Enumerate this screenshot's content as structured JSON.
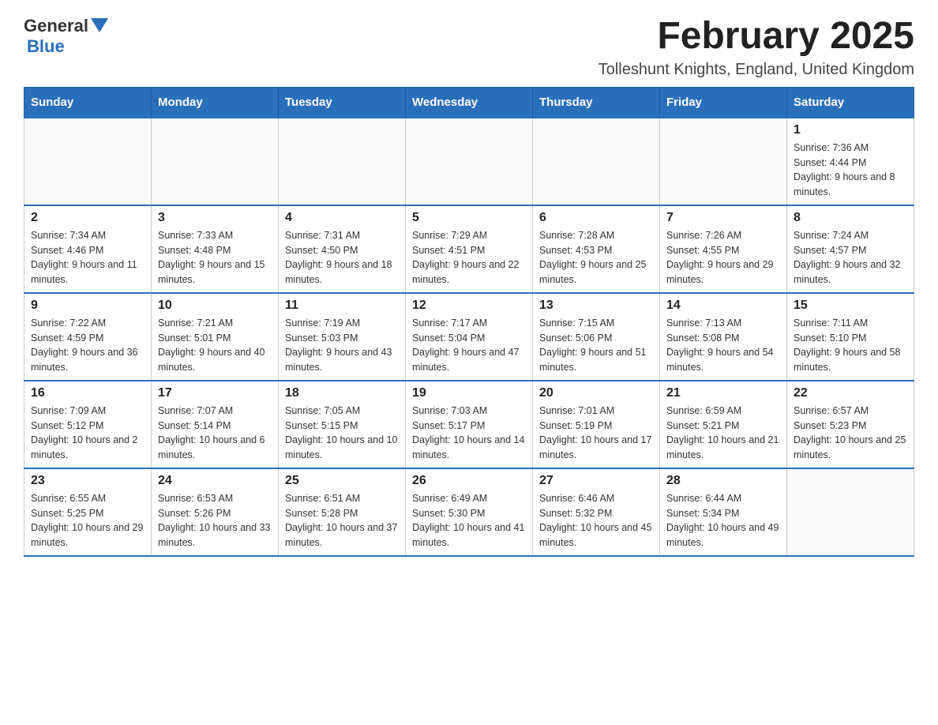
{
  "header": {
    "logo": {
      "general": "General",
      "blue": "Blue"
    },
    "title": "February 2025",
    "location": "Tolleshunt Knights, England, United Kingdom"
  },
  "days_of_week": [
    "Sunday",
    "Monday",
    "Tuesday",
    "Wednesday",
    "Thursday",
    "Friday",
    "Saturday"
  ],
  "weeks": [
    [
      {
        "day": "",
        "info": ""
      },
      {
        "day": "",
        "info": ""
      },
      {
        "day": "",
        "info": ""
      },
      {
        "day": "",
        "info": ""
      },
      {
        "day": "",
        "info": ""
      },
      {
        "day": "",
        "info": ""
      },
      {
        "day": "1",
        "info": "Sunrise: 7:36 AM\nSunset: 4:44 PM\nDaylight: 9 hours and 8 minutes."
      }
    ],
    [
      {
        "day": "2",
        "info": "Sunrise: 7:34 AM\nSunset: 4:46 PM\nDaylight: 9 hours and 11 minutes."
      },
      {
        "day": "3",
        "info": "Sunrise: 7:33 AM\nSunset: 4:48 PM\nDaylight: 9 hours and 15 minutes."
      },
      {
        "day": "4",
        "info": "Sunrise: 7:31 AM\nSunset: 4:50 PM\nDaylight: 9 hours and 18 minutes."
      },
      {
        "day": "5",
        "info": "Sunrise: 7:29 AM\nSunset: 4:51 PM\nDaylight: 9 hours and 22 minutes."
      },
      {
        "day": "6",
        "info": "Sunrise: 7:28 AM\nSunset: 4:53 PM\nDaylight: 9 hours and 25 minutes."
      },
      {
        "day": "7",
        "info": "Sunrise: 7:26 AM\nSunset: 4:55 PM\nDaylight: 9 hours and 29 minutes."
      },
      {
        "day": "8",
        "info": "Sunrise: 7:24 AM\nSunset: 4:57 PM\nDaylight: 9 hours and 32 minutes."
      }
    ],
    [
      {
        "day": "9",
        "info": "Sunrise: 7:22 AM\nSunset: 4:59 PM\nDaylight: 9 hours and 36 minutes."
      },
      {
        "day": "10",
        "info": "Sunrise: 7:21 AM\nSunset: 5:01 PM\nDaylight: 9 hours and 40 minutes."
      },
      {
        "day": "11",
        "info": "Sunrise: 7:19 AM\nSunset: 5:03 PM\nDaylight: 9 hours and 43 minutes."
      },
      {
        "day": "12",
        "info": "Sunrise: 7:17 AM\nSunset: 5:04 PM\nDaylight: 9 hours and 47 minutes."
      },
      {
        "day": "13",
        "info": "Sunrise: 7:15 AM\nSunset: 5:06 PM\nDaylight: 9 hours and 51 minutes."
      },
      {
        "day": "14",
        "info": "Sunrise: 7:13 AM\nSunset: 5:08 PM\nDaylight: 9 hours and 54 minutes."
      },
      {
        "day": "15",
        "info": "Sunrise: 7:11 AM\nSunset: 5:10 PM\nDaylight: 9 hours and 58 minutes."
      }
    ],
    [
      {
        "day": "16",
        "info": "Sunrise: 7:09 AM\nSunset: 5:12 PM\nDaylight: 10 hours and 2 minutes."
      },
      {
        "day": "17",
        "info": "Sunrise: 7:07 AM\nSunset: 5:14 PM\nDaylight: 10 hours and 6 minutes."
      },
      {
        "day": "18",
        "info": "Sunrise: 7:05 AM\nSunset: 5:15 PM\nDaylight: 10 hours and 10 minutes."
      },
      {
        "day": "19",
        "info": "Sunrise: 7:03 AM\nSunset: 5:17 PM\nDaylight: 10 hours and 14 minutes."
      },
      {
        "day": "20",
        "info": "Sunrise: 7:01 AM\nSunset: 5:19 PM\nDaylight: 10 hours and 17 minutes."
      },
      {
        "day": "21",
        "info": "Sunrise: 6:59 AM\nSunset: 5:21 PM\nDaylight: 10 hours and 21 minutes."
      },
      {
        "day": "22",
        "info": "Sunrise: 6:57 AM\nSunset: 5:23 PM\nDaylight: 10 hours and 25 minutes."
      }
    ],
    [
      {
        "day": "23",
        "info": "Sunrise: 6:55 AM\nSunset: 5:25 PM\nDaylight: 10 hours and 29 minutes."
      },
      {
        "day": "24",
        "info": "Sunrise: 6:53 AM\nSunset: 5:26 PM\nDaylight: 10 hours and 33 minutes."
      },
      {
        "day": "25",
        "info": "Sunrise: 6:51 AM\nSunset: 5:28 PM\nDaylight: 10 hours and 37 minutes."
      },
      {
        "day": "26",
        "info": "Sunrise: 6:49 AM\nSunset: 5:30 PM\nDaylight: 10 hours and 41 minutes."
      },
      {
        "day": "27",
        "info": "Sunrise: 6:46 AM\nSunset: 5:32 PM\nDaylight: 10 hours and 45 minutes."
      },
      {
        "day": "28",
        "info": "Sunrise: 6:44 AM\nSunset: 5:34 PM\nDaylight: 10 hours and 49 minutes."
      },
      {
        "day": "",
        "info": ""
      }
    ]
  ]
}
